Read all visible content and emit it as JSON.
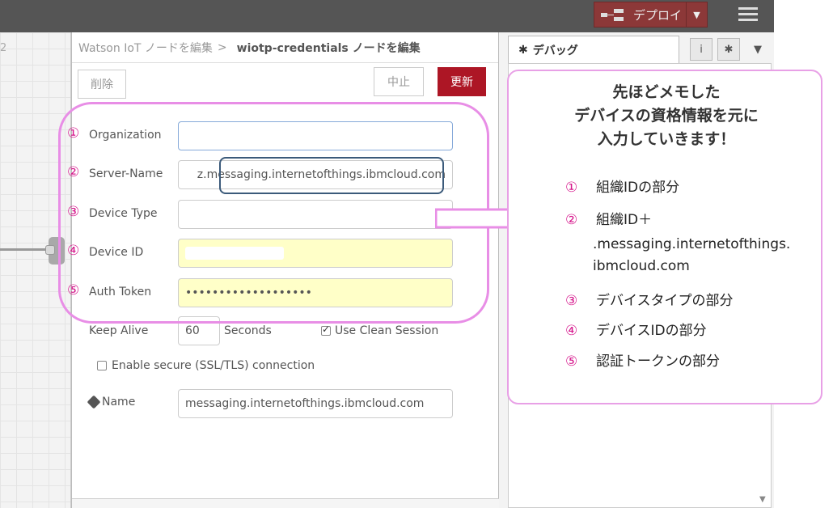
{
  "header": {
    "deploy_label": "デプロイ",
    "deploy_caret": "▼"
  },
  "workspace": {
    "tab_number": "2"
  },
  "editor": {
    "breadcrumb_parent": "Watson IoT ノードを編集",
    "breadcrumb_sep": ">",
    "breadcrumb_current": "wiotp-credentials ノードを編集",
    "delete_label": "削除",
    "cancel_label": "中止",
    "update_label": "更新",
    "fields": {
      "organization_label": "Organization",
      "server_name_label": "Server-Name",
      "server_name_value": "z.messaging.internetofthings.ibmcloud.com",
      "device_type_label": "Device Type",
      "device_id_label": "Device ID",
      "auth_token_label": "Auth Token",
      "auth_token_value": "•••••••••••••••••••",
      "keep_alive_label": "Keep Alive",
      "keep_alive_value": "60",
      "seconds_label": "Seconds",
      "clean_session_label": "Use Clean Session",
      "clean_session_checked": true,
      "ssl_label": "Enable secure (SSL/TLS) connection",
      "ssl_checked": false,
      "name_label": "Name",
      "name_value": "messaging.internetofthings.ibmcloud.com"
    }
  },
  "markers": [
    "①",
    "②",
    "③",
    "④",
    "⑤"
  ],
  "sidebar": {
    "tab_label": "デバッグ",
    "info_button": "i"
  },
  "callout": {
    "title_line1": "先ほどメモした",
    "title_line2": "デバイスの資格情報を元に",
    "title_line3": "入力していきます！",
    "item1": "組織IDの部分",
    "item2_line1": "組織ID＋",
    "item2_line2": ".messaging.internetofthings.",
    "item2_line3": "ibmcloud.com",
    "item3": "デバイスタイプの部分",
    "item4": "デバイスIDの部分",
    "item5": "認証トークンの部分"
  },
  "colors": {
    "header_bg": "#555555",
    "deploy_bg": "#8c3838",
    "update_bg": "#ad1625",
    "annotation_pink": "#e88ee6",
    "marker_magenta": "#d6168c",
    "highlight_box": "#3b5a7a",
    "required_field_bg": "#ffffc8"
  }
}
